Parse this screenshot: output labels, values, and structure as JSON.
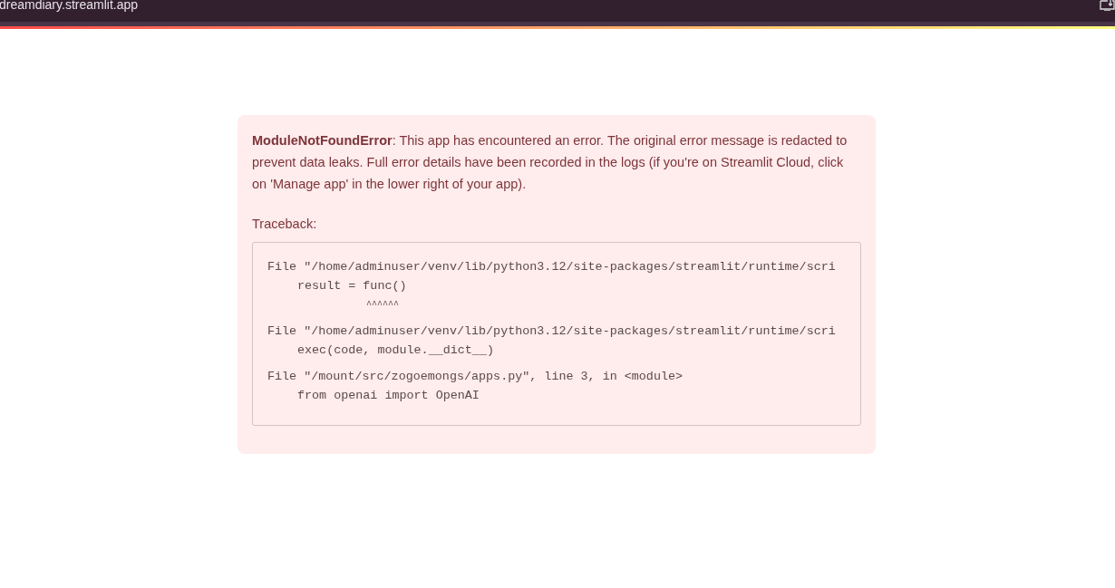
{
  "browser_bar": {
    "url": "dreamdiary.streamlit.app"
  },
  "error": {
    "name": "ModuleNotFoundError",
    "message": ": This app has encountered an error. The original error message is redacted to prevent data leaks. Full error details have been recorded in the logs (if you're on Streamlit Cloud, click on 'Manage app' in the lower right of your app).",
    "traceback_label": "Traceback:",
    "frames": [
      {
        "file_line": "File \"/home/adminuser/venv/lib/python3.12/site-packages/streamlit/runtime/scri",
        "code_line": "result = func()",
        "marker_line": "^^^^^^"
      },
      {
        "file_line": "File \"/home/adminuser/venv/lib/python3.12/site-packages/streamlit/runtime/scri",
        "code_line": "exec(code, module.__dict__)"
      },
      {
        "file_line": "File \"/mount/src/zogoemongs/apps.py\", line 3, in <module>",
        "code_line": "from openai import OpenAI"
      }
    ]
  }
}
